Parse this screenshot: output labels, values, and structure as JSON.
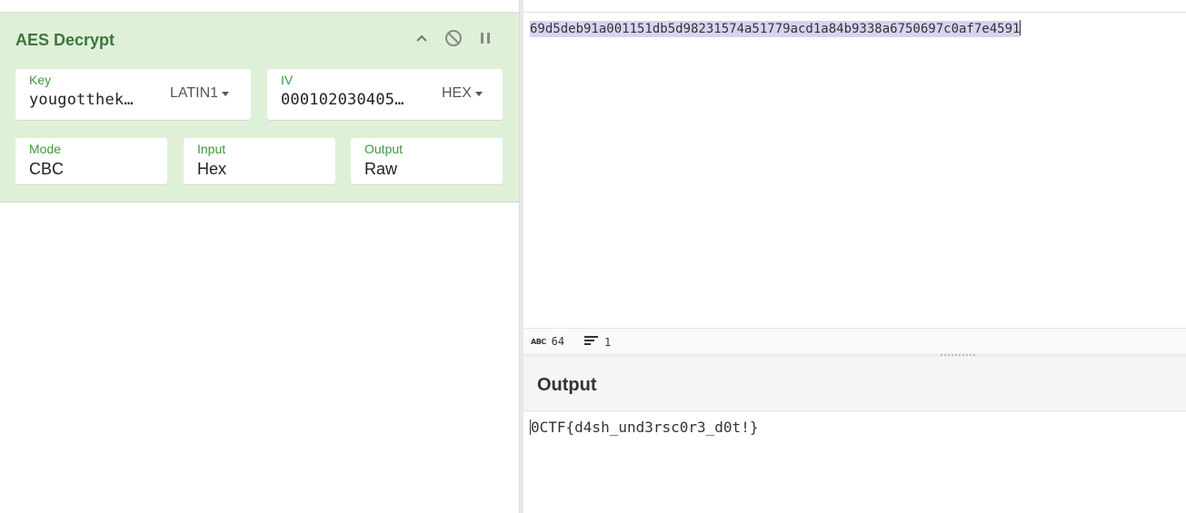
{
  "recipe": {
    "operation": {
      "title": "AES Decrypt",
      "controls": {
        "collapse_icon": "chevron-up-icon",
        "disable_icon": "disable-icon",
        "pause_icon": "pause-icon"
      },
      "key": {
        "label": "Key",
        "value": "yougotthek…",
        "encoding": "LATIN1"
      },
      "iv": {
        "label": "IV",
        "value": "000102030405…",
        "encoding": "HEX"
      },
      "mode": {
        "label": "Mode",
        "value": "CBC"
      },
      "input": {
        "label": "Input",
        "value": "Hex"
      },
      "output": {
        "label": "Output",
        "value": "Raw"
      }
    }
  },
  "input_pane": {
    "text": "69d5deb91a001151db5d98231574a51779acd1a84b9338a6750697c0af7e4591",
    "status": {
      "chars_icon": "abc-icon",
      "chars": "64",
      "lines_icon": "lines-icon",
      "lines": "1"
    }
  },
  "output_pane": {
    "title": "Output",
    "text": "0CTF{d4sh_und3rsc0r3_d0t!}"
  },
  "colors": {
    "op_background": "#dff0d8",
    "op_title": "#3c763d",
    "field_label": "#3c9a3c",
    "selection": "#d7d4f0"
  }
}
